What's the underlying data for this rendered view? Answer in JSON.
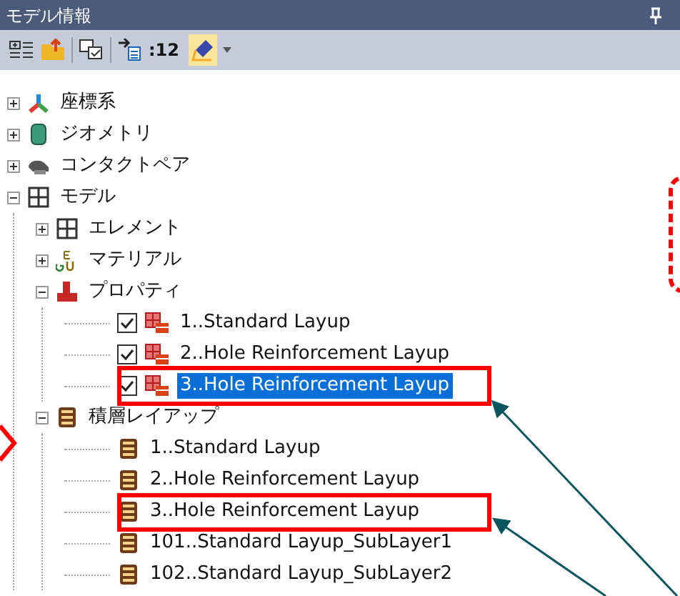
{
  "panel": {
    "title": "モデル情報"
  },
  "toolbar": {
    "count_label": ":12"
  },
  "tree": [
    {
      "label": "座標系",
      "kind": "axes",
      "expanded": false,
      "selected": false
    },
    {
      "label": "ジオメトリ",
      "kind": "cylinder",
      "expanded": false,
      "selected": false
    },
    {
      "label": "コンタクトペア",
      "kind": "contact",
      "expanded": false,
      "selected": false
    },
    {
      "label": "モデル",
      "kind": "grid",
      "expanded": true,
      "selected": false,
      "children": [
        {
          "label": "エレメント",
          "kind": "grid",
          "expanded": false,
          "selected": false
        },
        {
          "label": "マテリアル",
          "kind": "material",
          "expanded": false,
          "selected": false
        },
        {
          "label": "プロパティ",
          "kind": "property",
          "expanded": true,
          "selected": false,
          "children": [
            {
              "label": "1..Standard Layup",
              "kind": "layup-prop",
              "checked": true,
              "selected": false
            },
            {
              "label": "2..Hole Reinforcement Layup",
              "kind": "layup-prop",
              "checked": true,
              "selected": false
            },
            {
              "label": "3..Hole Reinforcement Layup",
              "kind": "layup-prop",
              "checked": true,
              "selected": true
            }
          ]
        },
        {
          "label": "積層レイアップ",
          "kind": "laminate",
          "expanded": true,
          "selected": false,
          "children": [
            {
              "label": "1..Standard Layup",
              "kind": "laminate",
              "selected": false
            },
            {
              "label": "2..Hole Reinforcement Layup",
              "kind": "laminate",
              "selected": false
            },
            {
              "label": "3..Hole Reinforcement Layup",
              "kind": "laminate",
              "selected": false
            },
            {
              "label": "101..Standard Layup_SubLayer1",
              "kind": "laminate",
              "selected": false
            },
            {
              "label": "102..Standard Layup_SubLayer2",
              "kind": "laminate",
              "selected": false
            }
          ]
        }
      ]
    }
  ]
}
